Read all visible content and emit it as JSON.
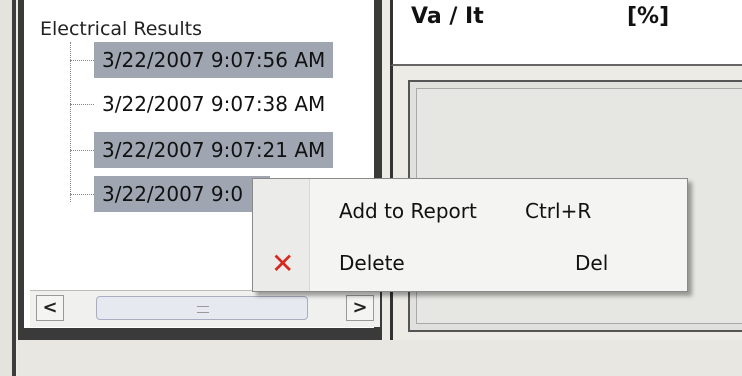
{
  "tree": {
    "root_label": "Electrical Results",
    "nodes": [
      {
        "label": "3/22/2007 9:07:56 AM",
        "selected": true
      },
      {
        "label": "3/22/2007 9:07:38 AM",
        "selected": false
      },
      {
        "label": "3/22/2007 9:07:21 AM",
        "selected": true
      },
      {
        "label": "3/22/2007 9:0",
        "selected": true
      }
    ],
    "scroll_left_glyph": "<",
    "scroll_right_glyph": ">"
  },
  "grid_header": {
    "col1": "Va / It",
    "col2": "[%]"
  },
  "context_menu": {
    "items": [
      {
        "label": "Add to Report",
        "shortcut": "Ctrl+R",
        "icon": ""
      },
      {
        "label": "Delete",
        "shortcut": "Del",
        "icon": "delete-x-icon"
      }
    ],
    "delete_icon_glyph": "✕",
    "icon_color": "#d6281e"
  },
  "colors": {
    "selection": "#9fa6b2"
  }
}
